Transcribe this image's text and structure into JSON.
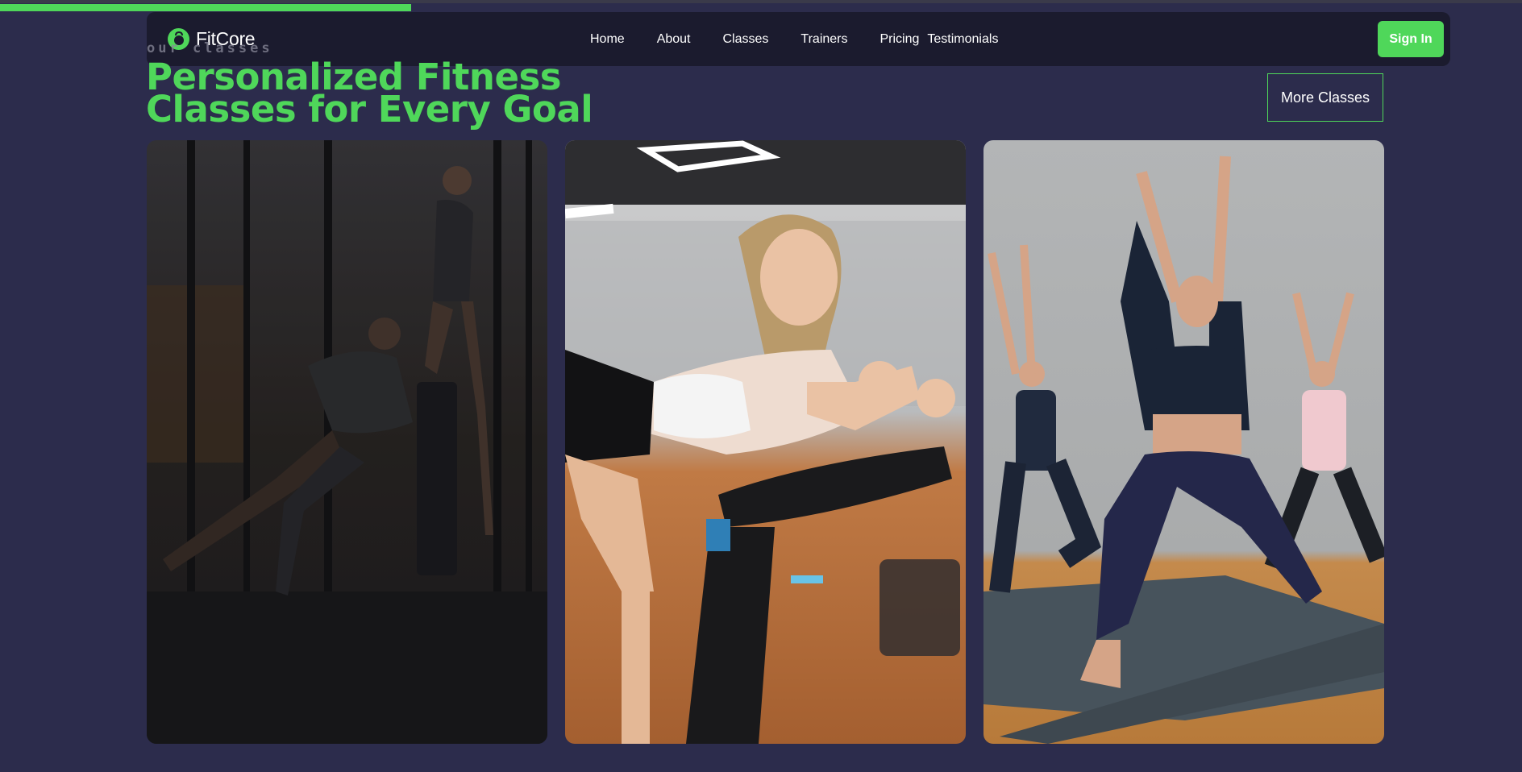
{
  "brand": {
    "name": "FitCore",
    "accent": "#4fd75a"
  },
  "progress": {
    "fraction": 0.27
  },
  "nav": {
    "items": [
      {
        "label": "Home"
      },
      {
        "label": "About"
      },
      {
        "label": "Classes"
      },
      {
        "label": "Trainers"
      },
      {
        "label": "Pricing"
      },
      {
        "label": "Testimonials"
      }
    ],
    "signin_label": "Sign In"
  },
  "section": {
    "eyebrow": "our classes",
    "heading": "Personalized Fitness Classes for Every Goal",
    "more_label": "More Classes"
  },
  "cards": [
    {
      "image": "gym-training-photo"
    },
    {
      "image": "spin-cycling-photo"
    },
    {
      "image": "yoga-class-photo"
    }
  ]
}
